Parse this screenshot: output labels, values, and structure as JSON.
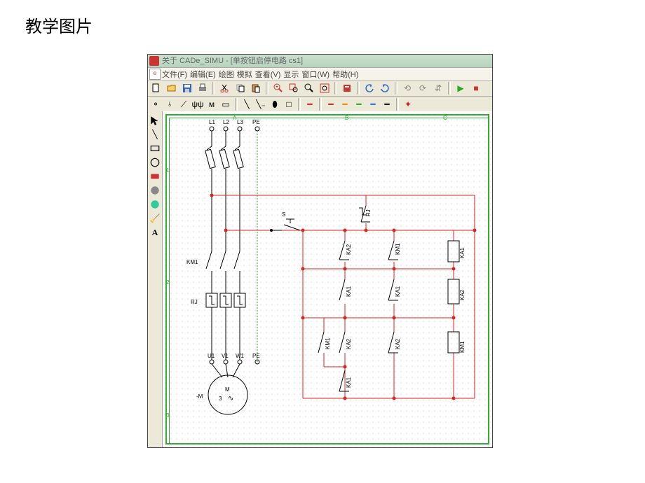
{
  "page": {
    "title": "教学图片"
  },
  "window": {
    "title": "关于 CADe_SIMU    - [单按钮启停电路 cs1]"
  },
  "menu": {
    "items": [
      "文件(F)",
      "编辑(E)",
      "绘图",
      "模拟",
      "查看(V)",
      "显示",
      "窗口(W)",
      "帮助(H)"
    ]
  },
  "schematic": {
    "terminals_top": [
      "L1",
      "L2",
      "L3",
      "PE"
    ],
    "terminals_bottom": [
      "U1",
      "V1",
      "W1",
      "PE"
    ],
    "labels": {
      "km1": "KM1",
      "rj": "RJ",
      "s": "S",
      "rj2": "RJ",
      "ka1": "KA1",
      "ka2": "KA2",
      "motor_m": "M",
      "motor_3": "3",
      "motor_tag": "-M"
    },
    "col_headers": [
      "A",
      "B",
      "C"
    ],
    "row_headers": [
      "1",
      "2",
      "3"
    ]
  }
}
